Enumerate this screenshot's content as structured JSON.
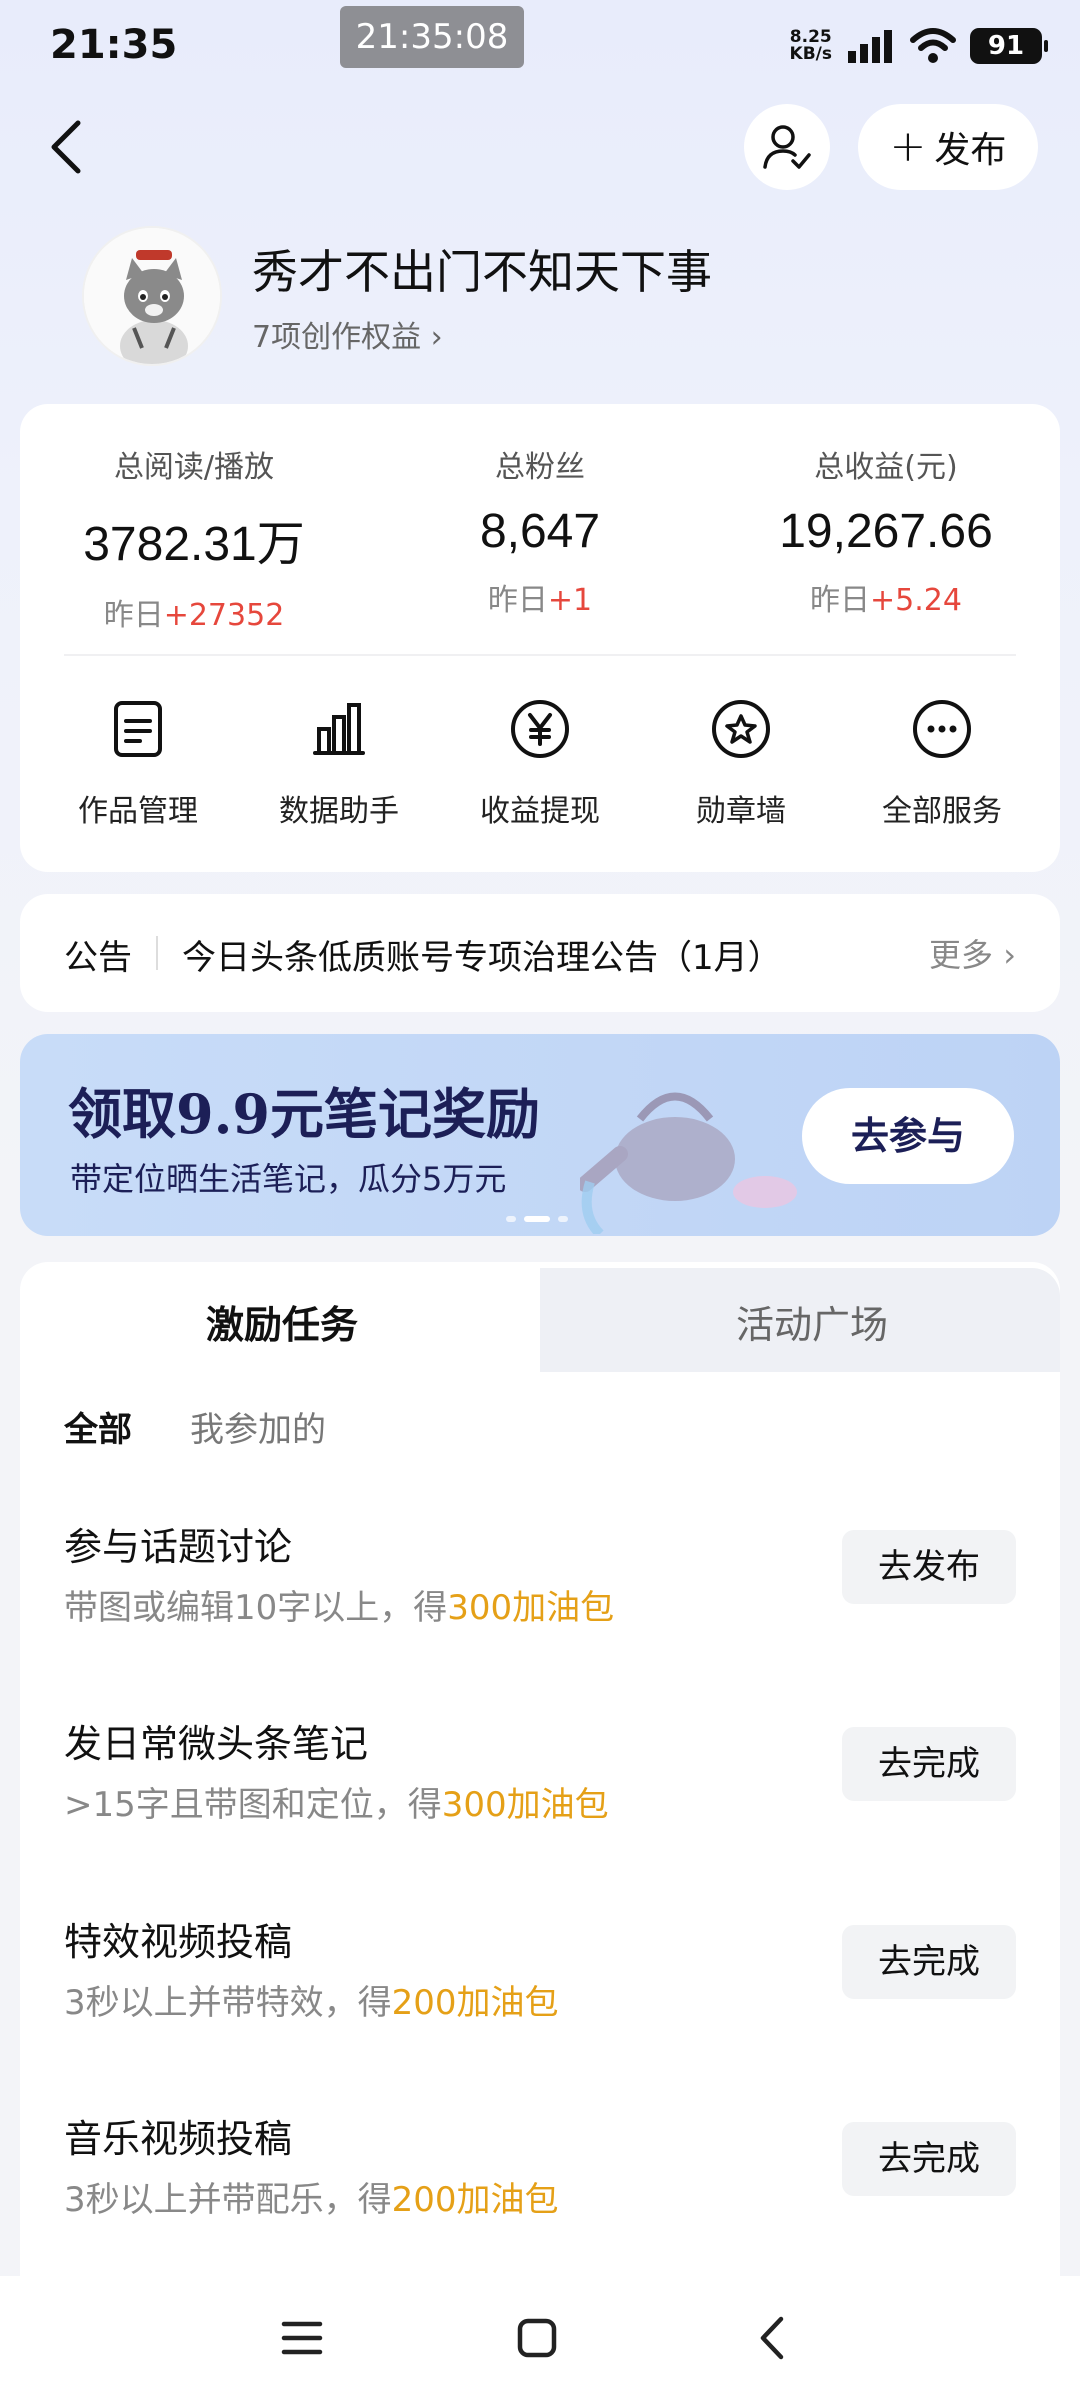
{
  "status_bar": {
    "time": "21:35",
    "toast_time": "21:35:08",
    "net_speed_value": "8.25",
    "net_speed_unit": "KB/s",
    "battery": "91"
  },
  "header": {
    "publish_label": "发布",
    "publish_icon": "plus-icon",
    "user_icon": "user-check-icon",
    "back_icon": "chevron-left-icon"
  },
  "profile": {
    "name": "秀才不出门不知天下事",
    "rights": "7项创作权益 ›"
  },
  "stats": [
    {
      "label": "总阅读/播放",
      "value": "3782.31万",
      "delta_prefix": "昨日",
      "delta": "+27352"
    },
    {
      "label": "总粉丝",
      "value": "8,647",
      "delta_prefix": "昨日",
      "delta": "+1"
    },
    {
      "label": "总收益(元)",
      "value": "19,267.66",
      "delta_prefix": "昨日",
      "delta": "+5.24"
    }
  ],
  "tools": [
    {
      "label": "作品管理",
      "icon": "document-icon"
    },
    {
      "label": "数据助手",
      "icon": "bar-chart-icon"
    },
    {
      "label": "收益提现",
      "icon": "yuan-icon"
    },
    {
      "label": "勋章墙",
      "icon": "badge-icon"
    },
    {
      "label": "全部服务",
      "icon": "more-icon"
    }
  ],
  "notice": {
    "tag": "公告",
    "text": "今日头条低质账号专项治理公告（1月）",
    "more": "更多 ›"
  },
  "banner": {
    "title": "领取9.9元笔记奖励",
    "subtitle": "带定位晒生活笔记，瓜分5万元",
    "button": "去参与"
  },
  "tasks": {
    "tabs": [
      "激励任务",
      "活动广场"
    ],
    "filters": [
      "全部",
      "我参加的"
    ],
    "items": [
      {
        "title": "参与话题讨论",
        "desc": "带图或编辑10字以上，得",
        "reward": "300加油包",
        "button": "去发布"
      },
      {
        "title": "发日常微头条笔记",
        "desc": ">15字且带图和定位，得",
        "reward": "300加油包",
        "button": "去完成"
      },
      {
        "title": "特效视频投稿",
        "desc": "3秒以上并带特效，得",
        "reward": "200加油包",
        "button": "去完成"
      },
      {
        "title": "音乐视频投稿",
        "desc": "3秒以上并带配乐，得",
        "reward": "200加油包",
        "button": "去完成"
      }
    ]
  },
  "colors": {
    "accent_red": "#e6473c",
    "reward_gold": "#e5a017",
    "banner_navy": "#1c1f57"
  }
}
